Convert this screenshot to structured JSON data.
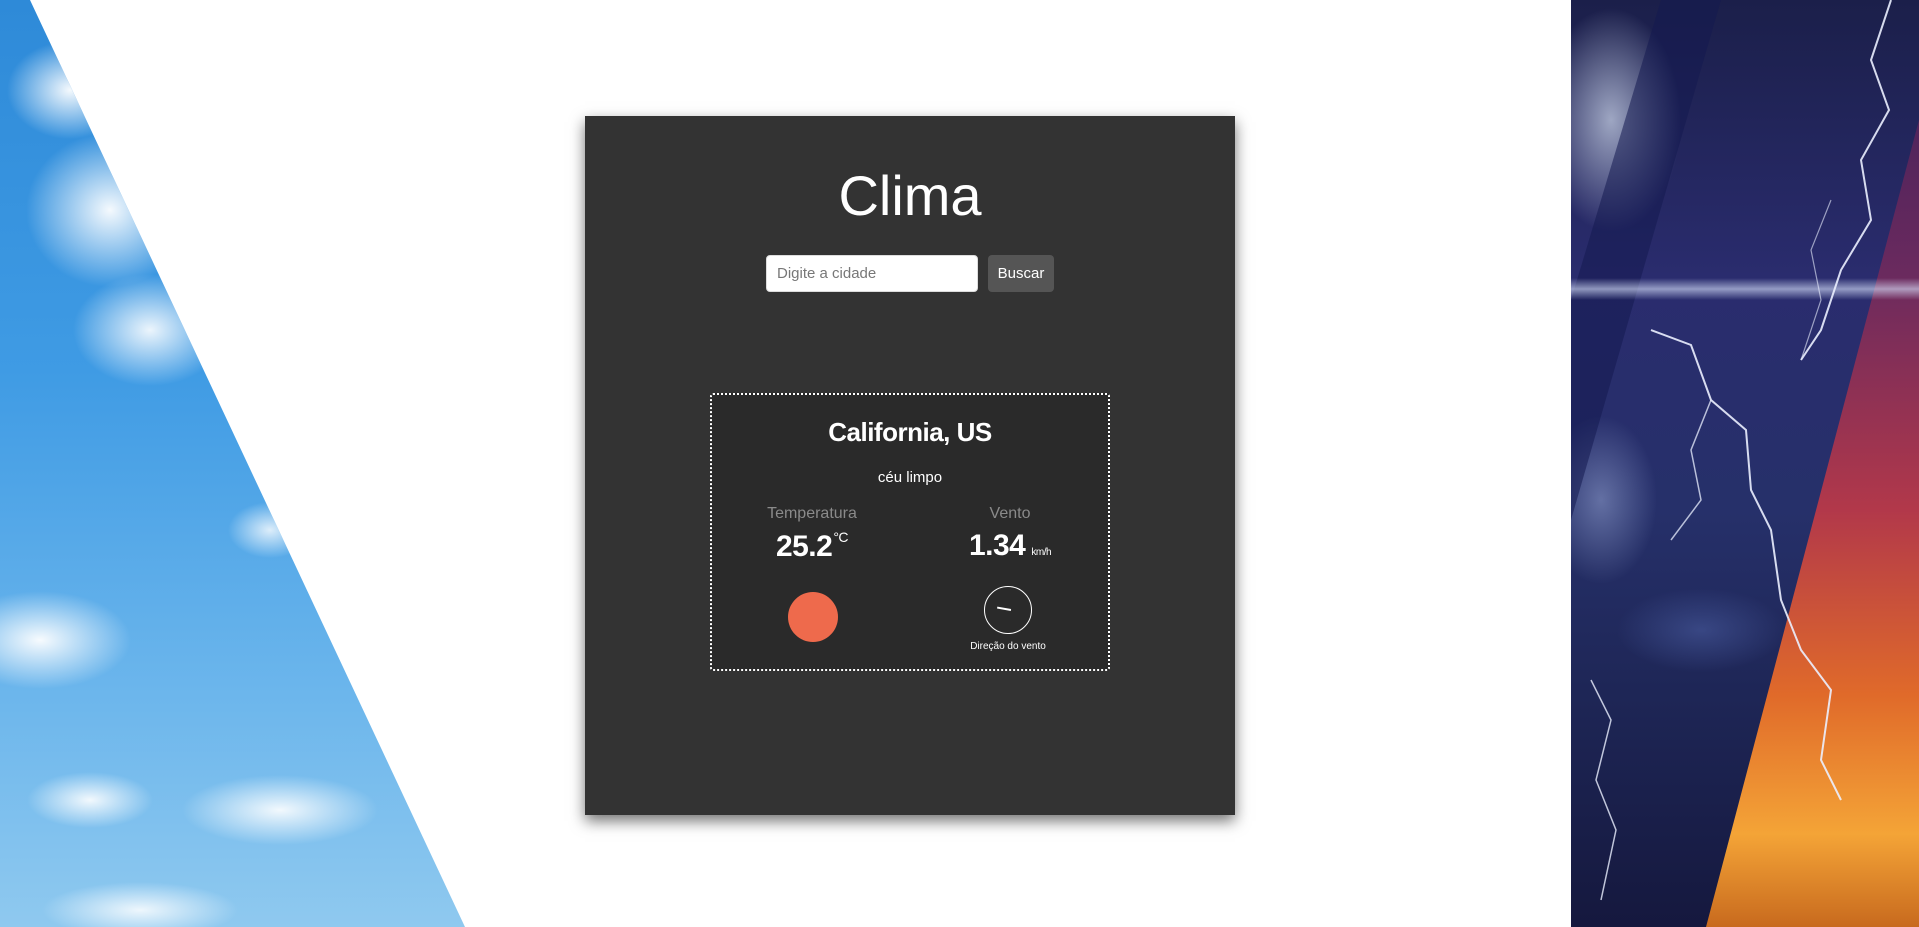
{
  "app": {
    "title": "Clima"
  },
  "search": {
    "placeholder": "Digite a cidade",
    "value": "",
    "button_label": "Buscar"
  },
  "weather": {
    "location": "California, US",
    "description": "céu limpo",
    "temperature": {
      "label": "Temperatura",
      "value": "25.2",
      "unit": "°C",
      "indicator_icon": "sun-icon",
      "indicator_color": "#ee6a4c"
    },
    "wind": {
      "label": "Vento",
      "value": "1.34",
      "unit": "km/h",
      "direction_icon": "compass-icon",
      "direction_label": "Direção do vento"
    }
  },
  "colors": {
    "page_background": "#ffffff",
    "panel_background": "#333333",
    "card_background": "#2a2a2a",
    "button_background": "#555555",
    "label_gray": "#8a8a8a"
  }
}
